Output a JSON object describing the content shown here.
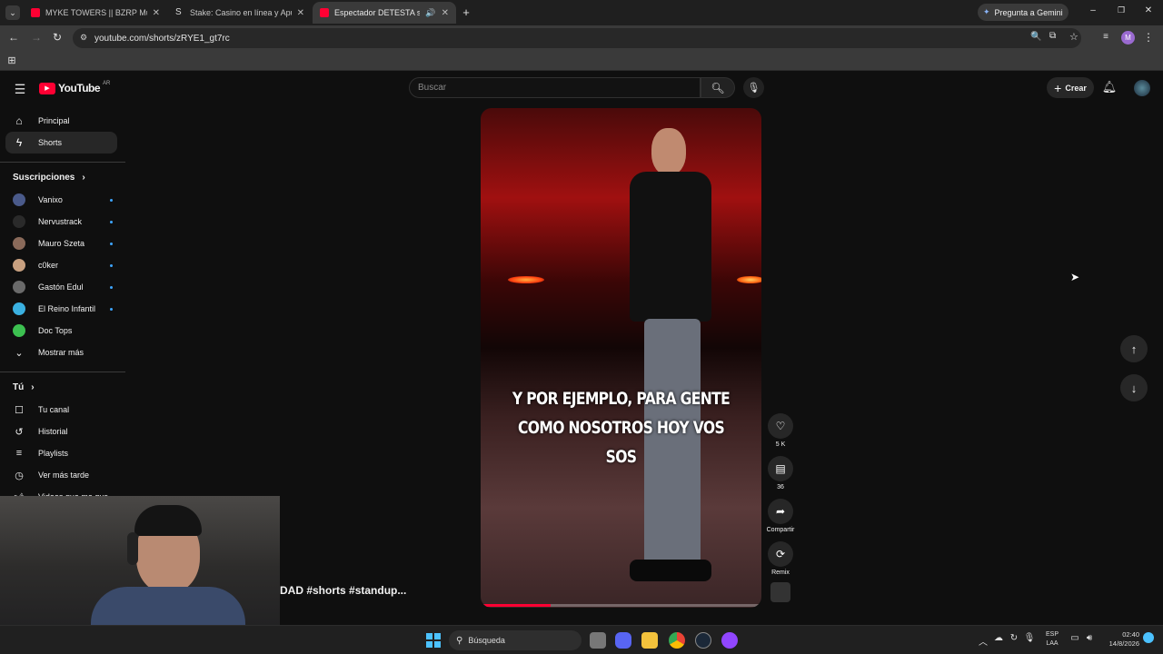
{
  "browser": {
    "tabs": [
      {
        "title": "MYKE TOWERS || BZRP Music Se",
        "favicon_color": "#ff0033"
      },
      {
        "title": "Stake: Casino en línea y Apuest",
        "favicon_color": "#cccccc"
      },
      {
        "title": "Espectador DETESTA su CIUD",
        "favicon_color": "#ff0033"
      }
    ],
    "gemini_label": "Pregunta a Gemini",
    "url": "youtube.com/shorts/zRYE1_gt7rc",
    "profile_initial": "M"
  },
  "youtube": {
    "logo_text": "YouTube",
    "region": "AR",
    "search_placeholder": "Buscar",
    "create_label": "Crear",
    "nav": [
      {
        "label": "Principal",
        "icon": "home-icon"
      },
      {
        "label": "Shorts",
        "icon": "shorts-icon"
      }
    ],
    "subscriptions_title": "Suscripciones",
    "subscriptions": [
      {
        "label": "Vanixo",
        "color": "#4a5a8a"
      },
      {
        "label": "Nervustrack",
        "color": "#2a2a2a"
      },
      {
        "label": "Mauro Szeta",
        "color": "#8a6a5a"
      },
      {
        "label": "c0ker",
        "color": "#c8a080"
      },
      {
        "label": "Gastón Edul",
        "color": "#6a6a6a"
      },
      {
        "label": "El Reino Infantil",
        "color": "#3ab0e0"
      },
      {
        "label": "Doc Tops",
        "color": "#3cc050"
      }
    ],
    "show_more": "Mostrar más",
    "you_title": "Tú",
    "you_items": [
      {
        "label": "Tu canal",
        "icon": "channel-icon"
      },
      {
        "label": "Historial",
        "icon": "history-icon"
      },
      {
        "label": "Playlists",
        "icon": "playlists-icon"
      },
      {
        "label": "Ver más tarde",
        "icon": "watch-later-icon"
      },
      {
        "label": "Videos que me gus",
        "icon": "like-icon"
      }
    ],
    "short": {
      "caption_line1": "Y POR EJEMPLO, PARA GENTE",
      "caption_line2": "COMO NOSOTROS HOY VOS SOS",
      "title_partial": "DAD #shorts  #standup..."
    },
    "actions": [
      {
        "label": "5 K",
        "icon": "like-icon"
      },
      {
        "label": "36",
        "icon": "comment-icon"
      },
      {
        "label": "Compartir",
        "icon": "share-icon"
      },
      {
        "label": "Remix",
        "icon": "remix-icon"
      }
    ]
  },
  "taskbar": {
    "search_label": "Búsqueda",
    "lang_line1": "ESP",
    "lang_line2": "LAA",
    "time": "02:40",
    "date": "14/8/2026"
  }
}
